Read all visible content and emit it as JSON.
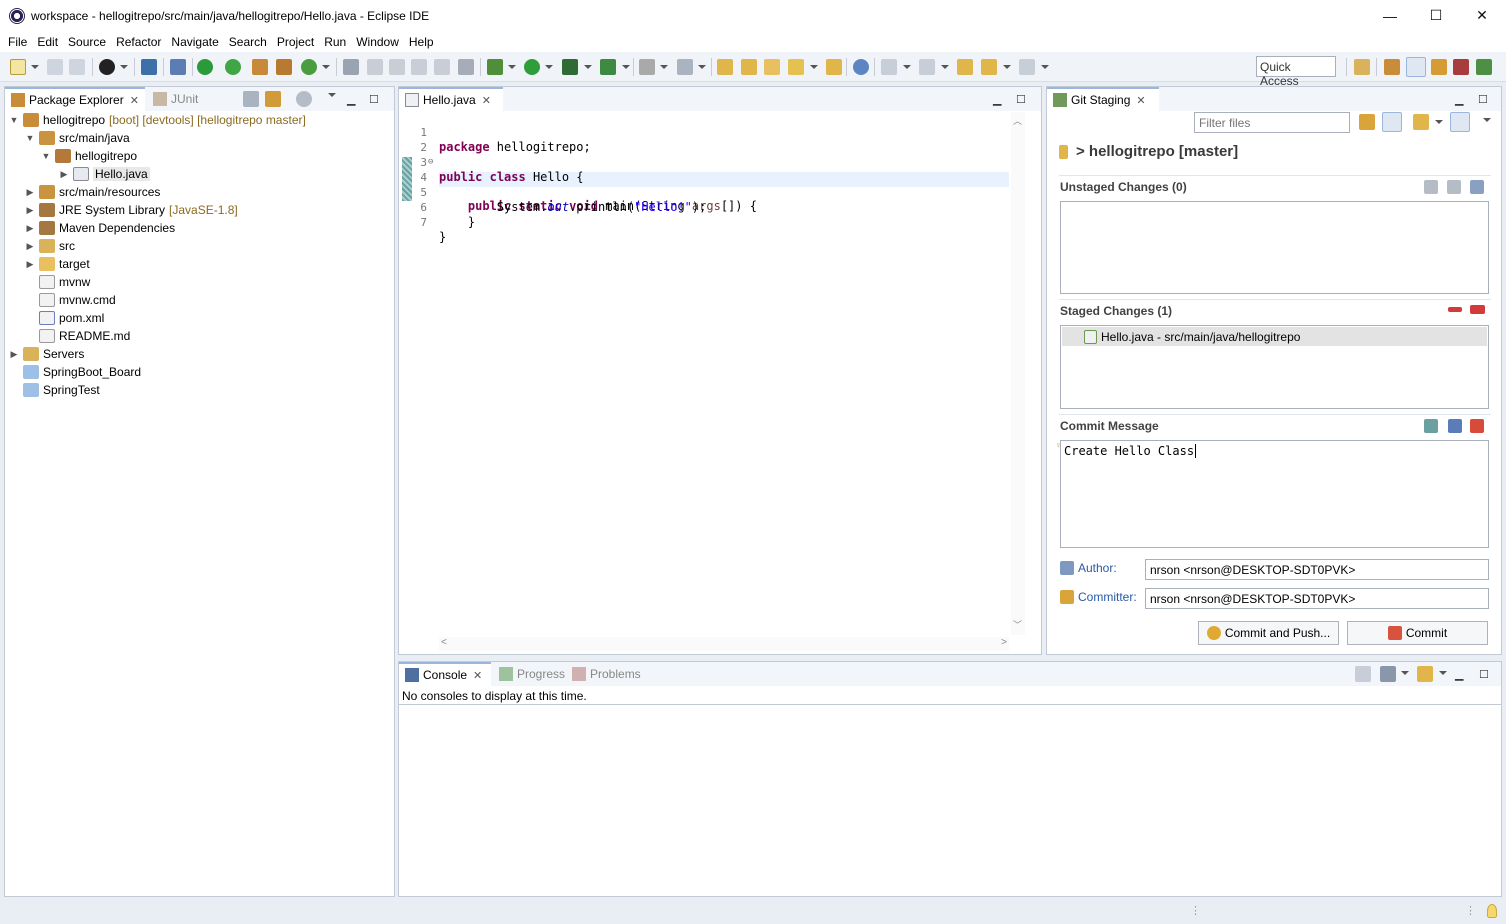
{
  "window": {
    "title": "workspace - hellogitrepo/src/main/java/hellogitrepo/Hello.java - Eclipse IDE",
    "minimize": "—",
    "maximize": "☐",
    "close": "✕"
  },
  "menubar": [
    "File",
    "Edit",
    "Source",
    "Refactor",
    "Navigate",
    "Search",
    "Project",
    "Run",
    "Window",
    "Help"
  ],
  "toolbar": {
    "quick_access": "Quick Access"
  },
  "package_explorer": {
    "tab_label": "Package Explorer",
    "second_tab_label": "JUnit",
    "tree": [
      {
        "label": "hellogitrepo",
        "decoration": "[boot] [devtools] [hellogitrepo master]",
        "icon": "project-icon"
      },
      {
        "label": "src/main/java",
        "icon": "source-folder-icon"
      },
      {
        "label": "hellogitrepo",
        "icon": "package-icon"
      },
      {
        "label": "Hello.java",
        "icon": "java-file-icon"
      },
      {
        "label": "src/main/resources",
        "icon": "source-folder-icon"
      },
      {
        "label": "JRE System Library",
        "decoration": "[JavaSE-1.8]",
        "icon": "library-icon"
      },
      {
        "label": "Maven Dependencies",
        "icon": "library-icon"
      },
      {
        "label": "src",
        "icon": "folder-icon"
      },
      {
        "label": "target",
        "icon": "folder-icon"
      },
      {
        "label": "mvnw",
        "icon": "file-icon"
      },
      {
        "label": "mvnw.cmd",
        "icon": "file-icon"
      },
      {
        "label": "pom.xml",
        "icon": "xml-file-icon"
      },
      {
        "label": "README.md",
        "icon": "file-icon"
      },
      {
        "label": "Servers",
        "icon": "folder-icon"
      },
      {
        "label": "SpringBoot_Board",
        "icon": "project-icon"
      },
      {
        "label": "SpringTest",
        "icon": "project-icon"
      }
    ]
  },
  "editor": {
    "tab_label": "Hello.java",
    "line_numbers": [
      "1",
      "2",
      "3",
      "4",
      "5",
      "6",
      "7"
    ],
    "lines": {
      "l1_kw": "package",
      "l1_rest": " hellogitrepo;",
      "l3_kw1": "public",
      "l3_kw2": "class",
      "l3_rest": " Hello {",
      "l4_kw1": "public",
      "l4_kw2": "static",
      "l4_kw3": "void",
      "l4_mid": " main(String ",
      "l4_param": "args",
      "l4_end": "[]) {",
      "l5_pre": "System.",
      "l5_field": "out",
      "l5_mid": ".println(",
      "l5_str": "\"Hello!\"",
      "l5_end": ");",
      "l6": "    }",
      "l7": "}"
    }
  },
  "git_staging": {
    "tab_label": "Git Staging",
    "filter_placeholder": "Filter files",
    "repo_title": "> hellogitrepo [master]",
    "unstaged_label": "Unstaged Changes (0)",
    "staged_label": "Staged Changes (1)",
    "staged_items": [
      "Hello.java - src/main/java/hellogitrepo"
    ],
    "commit_message_label": "Commit Message",
    "commit_message": "Create Hello Class",
    "author_label": "Author:",
    "author_value": "nrson <nrson@DESKTOP-SDT0PVK>",
    "committer_label": "Committer:",
    "committer_value": "nrson <nrson@DESKTOP-SDT0PVK>",
    "commit_and_push_label": "Commit and Push...",
    "commit_label": "Commit"
  },
  "bottom_panel": {
    "tabs": [
      "Console",
      "Progress",
      "Problems"
    ],
    "message": "No consoles to display at this time."
  },
  "colors": {
    "accent": "#9bb6dc",
    "keyword": "#7f0055",
    "string": "#2a00ff",
    "field": "#0000c0",
    "link": "#2a5aa5"
  }
}
